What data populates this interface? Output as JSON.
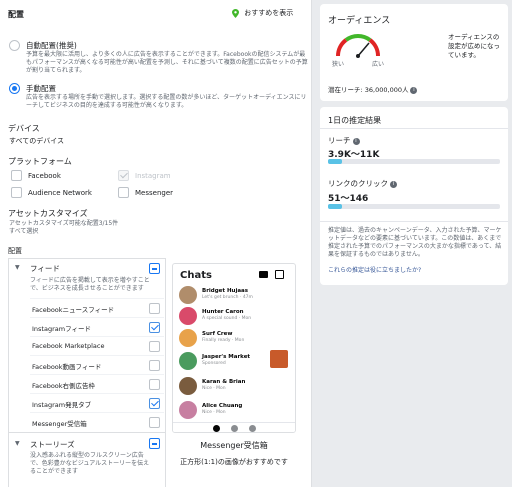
{
  "placements": {
    "title": "配置",
    "recommend_link": "おすすめを表示",
    "auto_title": "自動配置(推奨)",
    "auto_desc": "予算を最大限に活用し、より多くの人に広告を表示することができます。Facebookの配信システムが最もパフォーマンスが高くなる可能性が高い配置を予測し、それに基づいて複数の配置に広告セットの予算が割り当てられます。",
    "manual_title": "手動配置",
    "manual_desc": "広告を表示する場所を手動で選択します。選択する配置の数が多いほど、ターゲットオーディエンスにリーチしてビジネスの目的を達成する可能性が高くなります。",
    "devices_title": "デバイス",
    "devices_value": "すべてのデバイス",
    "platforms_title": "プラットフォーム",
    "platforms": [
      {
        "label": "Facebook",
        "checked": false
      },
      {
        "label": "Instagram",
        "checked": true
      },
      {
        "label": "Audience Network",
        "checked": false
      },
      {
        "label": "Messenger",
        "checked": false
      }
    ],
    "asset_title": "アセットカスタマイズ",
    "asset_desc": "アセットカスタマイズ可能な配置3/15件",
    "asset_link": "すべて選択",
    "placement_title": "配置",
    "feed_title": "フィード",
    "feed_desc": "フィードに広告を掲載して表示を増やすことで、ビジネスを成長させることができます",
    "feed_items": [
      {
        "label": "Facebookニュースフィード",
        "checked": false
      },
      {
        "label": "Instagramフィード",
        "checked": true
      },
      {
        "label": "Facebook Marketplace",
        "checked": false
      },
      {
        "label": "Facebook動画フィード",
        "checked": false
      },
      {
        "label": "Facebook右側広告枠",
        "checked": false
      },
      {
        "label": "Instagram発見タブ",
        "checked": true
      },
      {
        "label": "Messenger受信箱",
        "checked": false
      }
    ],
    "stories_title": "ストーリーズ",
    "stories_desc": "没入感あふれる縦型のフルスクリーン広告で、色彩豊かなビジュアルストーリーを伝えることができます",
    "preview_caption": "Messenger受信箱",
    "preview_note": "正方形(1:1)の画像がおすすめです"
  },
  "preview": {
    "header": "Chats",
    "chats": [
      {
        "name": "Bridget Hujaas",
        "msg": "Let's get brunch · 47m",
        "color": "#b08d6b"
      },
      {
        "name": "Hunter Caron",
        "msg": "A special sound · Mon",
        "color": "#d94a6a"
      },
      {
        "name": "Surf Crew",
        "msg": "Finally ready · Mon",
        "color": "#e8a24a"
      },
      {
        "name": "Jasper's Market",
        "msg": "Sponsored",
        "color": "#4a9b5e"
      },
      {
        "name": "Karan & Brian",
        "msg": "Nice · Mon",
        "color": "#7a5c3e"
      },
      {
        "name": "Alice Chuang",
        "msg": "Nice · Mon",
        "color": "#c77fa1"
      }
    ]
  },
  "audience": {
    "title": "オーディエンス",
    "desc": "オーディエンスの設定が広めになっています。",
    "narrow_label": "狭い",
    "wide_label": "広い",
    "reach_label": "潜在リーチ: 36,000,000人"
  },
  "estimate": {
    "title": "1日の推定結果",
    "reach_label": "リーチ",
    "reach_value": "3.9K〜11K",
    "reach_fill": 0.08,
    "clicks_label": "リンクのクリック",
    "clicks_value": "51〜146",
    "clicks_fill": 0.08,
    "disclaimer": "推定値は、過去のキャンペーンデータ、入力された予算、マーケットデータなどの要素に基づいています。この数値は、あくまで推定された予算でのパフォーマンスの大まかな指標であって、結果を保証するものではありません。",
    "helpful_link": "これらの推定は役に立ちましたか?"
  },
  "colors": {
    "accent": "#1877f2",
    "bar": "#59c2e6",
    "gauge_green": "#42b72a",
    "gauge_red": "#e02424"
  }
}
